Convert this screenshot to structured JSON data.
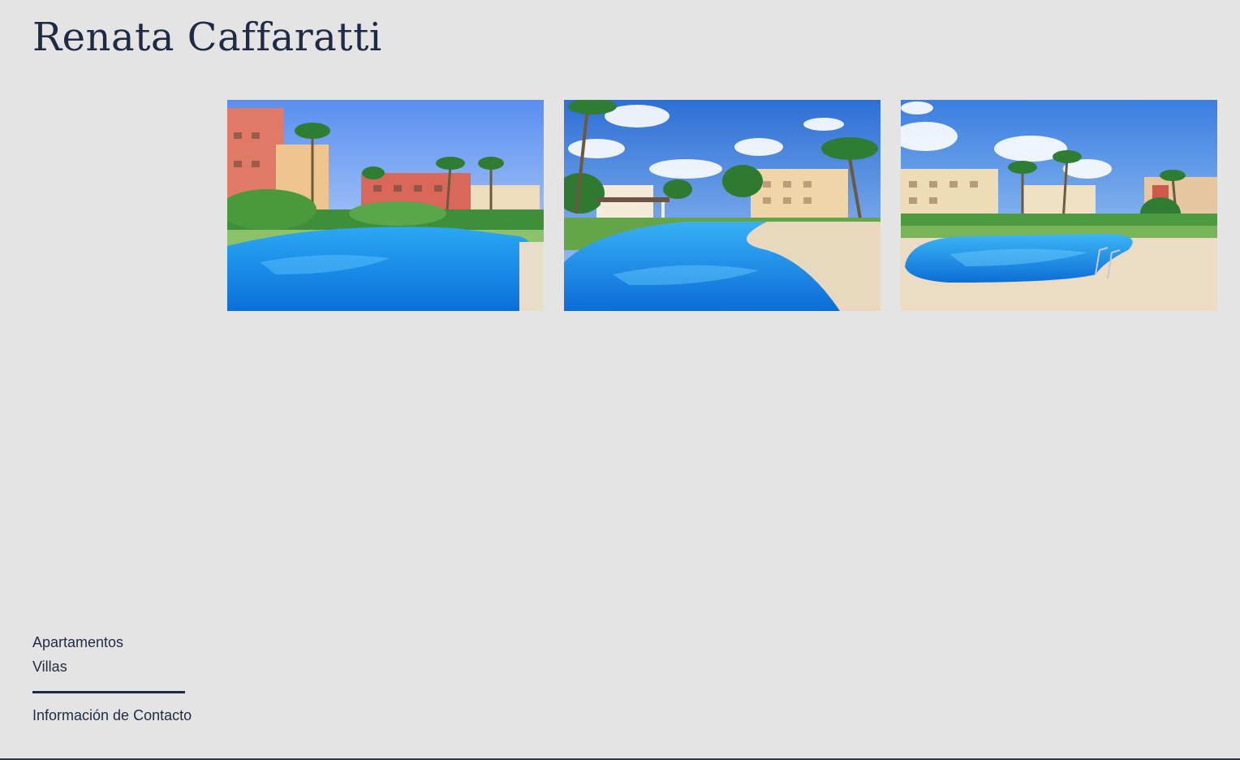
{
  "header": {
    "title": "Renata Caffaratti"
  },
  "gallery": {
    "photos": [
      {
        "name": "pool-photo-1"
      },
      {
        "name": "pool-photo-2"
      },
      {
        "name": "pool-photo-3"
      }
    ]
  },
  "menu": {
    "items": [
      {
        "label": "Apartamentos"
      },
      {
        "label": "Villas"
      }
    ],
    "contact_label": "Información de Contacto"
  },
  "colors": {
    "background": "#e4e4e4",
    "text": "#1f2a44"
  }
}
